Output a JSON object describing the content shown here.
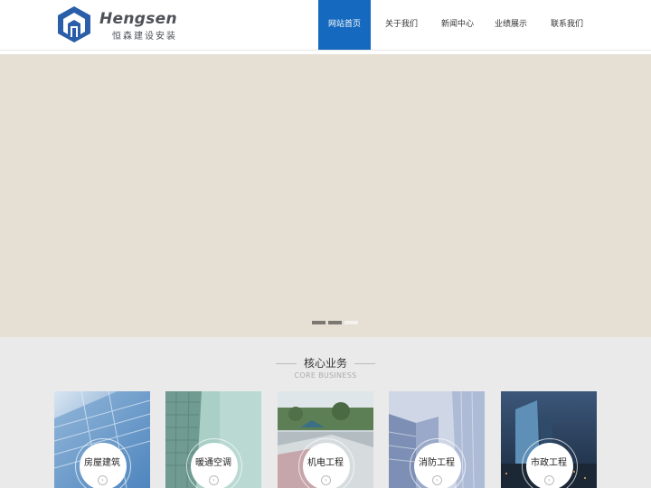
{
  "brand": {
    "name": "Hengsen",
    "subtitle": "恒森建设安装",
    "logo_icon": "hexagon-house-icon",
    "color": "#2a5ea8"
  },
  "nav": {
    "items": [
      {
        "label": "网站首页",
        "active": true
      },
      {
        "label": "关于我们",
        "active": false
      },
      {
        "label": "新闻中心",
        "active": false
      },
      {
        "label": "业绩展示",
        "active": false
      },
      {
        "label": "联系我们",
        "active": false
      }
    ],
    "active_color": "#1569bf"
  },
  "banner": {
    "background": "#e6dfd3",
    "slides_total": 3,
    "active_slide": 3
  },
  "core": {
    "title": "核心业务",
    "subtitle": "CORE BUSINESS",
    "cards": [
      {
        "label": "房屋建筑",
        "image": "glass-skyscraper-blue"
      },
      {
        "label": "暖通空调",
        "image": "green-glass-tower"
      },
      {
        "label": "机电工程",
        "image": "city-rooftop-aerial"
      },
      {
        "label": "消防工程",
        "image": "office-towers-sky"
      },
      {
        "label": "市政工程",
        "image": "night-skyline"
      }
    ],
    "arrow_icon": "chevron-right-circle-icon"
  }
}
